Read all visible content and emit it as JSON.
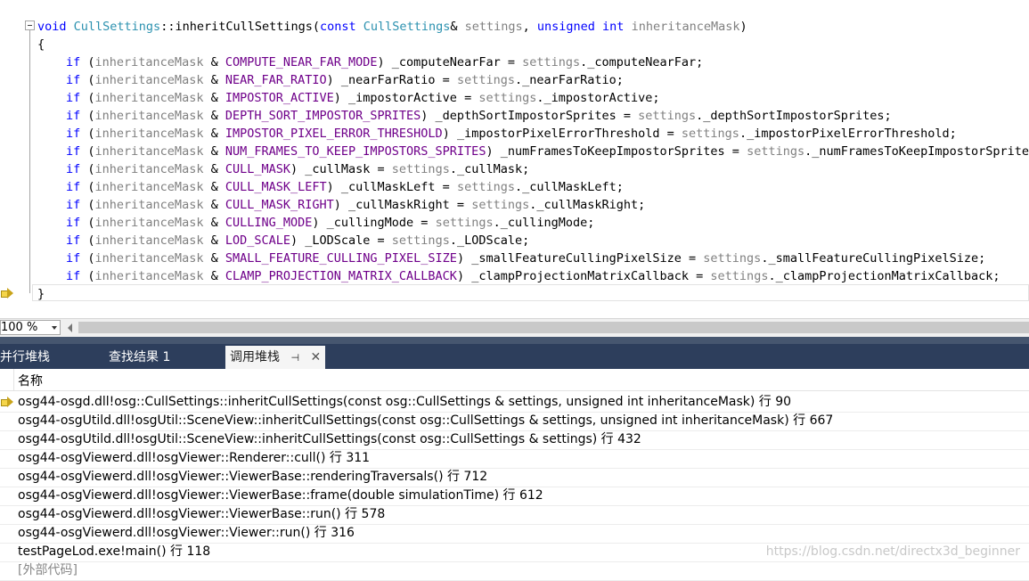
{
  "editor": {
    "code_lines": [
      [
        {
          "c": "kw",
          "t": "void"
        },
        {
          "c": "",
          "t": " "
        },
        {
          "c": "ty",
          "t": "CullSettings"
        },
        {
          "c": "",
          "t": "::inheritCullSettings("
        },
        {
          "c": "kw",
          "t": "const"
        },
        {
          "c": "",
          "t": " "
        },
        {
          "c": "ty",
          "t": "CullSettings"
        },
        {
          "c": "",
          "t": "& "
        },
        {
          "c": "pm",
          "t": "settings"
        },
        {
          "c": "",
          "t": ", "
        },
        {
          "c": "kw",
          "t": "unsigned int"
        },
        {
          "c": "",
          "t": " "
        },
        {
          "c": "pm",
          "t": "inheritanceMask"
        },
        {
          "c": "",
          "t": ")"
        }
      ],
      [
        {
          "c": "",
          "t": "{"
        }
      ],
      [
        {
          "c": "kw",
          "t": "if"
        },
        {
          "c": "",
          "t": " ("
        },
        {
          "c": "pm",
          "t": "inheritanceMask"
        },
        {
          "c": "",
          "t": " & "
        },
        {
          "c": "mc",
          "t": "COMPUTE_NEAR_FAR_MODE"
        },
        {
          "c": "",
          "t": ") _computeNearFar = "
        },
        {
          "c": "pm",
          "t": "settings"
        },
        {
          "c": "",
          "t": "._computeNearFar;"
        }
      ],
      [
        {
          "c": "kw",
          "t": "if"
        },
        {
          "c": "",
          "t": " ("
        },
        {
          "c": "pm",
          "t": "inheritanceMask"
        },
        {
          "c": "",
          "t": " & "
        },
        {
          "c": "mc",
          "t": "NEAR_FAR_RATIO"
        },
        {
          "c": "",
          "t": ") _nearFarRatio = "
        },
        {
          "c": "pm",
          "t": "settings"
        },
        {
          "c": "",
          "t": "._nearFarRatio;"
        }
      ],
      [
        {
          "c": "kw",
          "t": "if"
        },
        {
          "c": "",
          "t": " ("
        },
        {
          "c": "pm",
          "t": "inheritanceMask"
        },
        {
          "c": "",
          "t": " & "
        },
        {
          "c": "mc",
          "t": "IMPOSTOR_ACTIVE"
        },
        {
          "c": "",
          "t": ") _impostorActive = "
        },
        {
          "c": "pm",
          "t": "settings"
        },
        {
          "c": "",
          "t": "._impostorActive;"
        }
      ],
      [
        {
          "c": "kw",
          "t": "if"
        },
        {
          "c": "",
          "t": " ("
        },
        {
          "c": "pm",
          "t": "inheritanceMask"
        },
        {
          "c": "",
          "t": " & "
        },
        {
          "c": "mc",
          "t": "DEPTH_SORT_IMPOSTOR_SPRITES"
        },
        {
          "c": "",
          "t": ") _depthSortImpostorSprites = "
        },
        {
          "c": "pm",
          "t": "settings"
        },
        {
          "c": "",
          "t": "._depthSortImpostorSprites;"
        }
      ],
      [
        {
          "c": "kw",
          "t": "if"
        },
        {
          "c": "",
          "t": " ("
        },
        {
          "c": "pm",
          "t": "inheritanceMask"
        },
        {
          "c": "",
          "t": " & "
        },
        {
          "c": "mc",
          "t": "IMPOSTOR_PIXEL_ERROR_THRESHOLD"
        },
        {
          "c": "",
          "t": ") _impostorPixelErrorThreshold = "
        },
        {
          "c": "pm",
          "t": "settings"
        },
        {
          "c": "",
          "t": "._impostorPixelErrorThreshold;"
        }
      ],
      [
        {
          "c": "kw",
          "t": "if"
        },
        {
          "c": "",
          "t": " ("
        },
        {
          "c": "pm",
          "t": "inheritanceMask"
        },
        {
          "c": "",
          "t": " & "
        },
        {
          "c": "mc",
          "t": "NUM_FRAMES_TO_KEEP_IMPOSTORS_SPRITES"
        },
        {
          "c": "",
          "t": ") _numFramesToKeepImpostorSprites = "
        },
        {
          "c": "pm",
          "t": "settings"
        },
        {
          "c": "",
          "t": "._numFramesToKeepImpostorSprites;"
        }
      ],
      [
        {
          "c": "kw",
          "t": "if"
        },
        {
          "c": "",
          "t": " ("
        },
        {
          "c": "pm",
          "t": "inheritanceMask"
        },
        {
          "c": "",
          "t": " & "
        },
        {
          "c": "mc",
          "t": "CULL_MASK"
        },
        {
          "c": "",
          "t": ") _cullMask = "
        },
        {
          "c": "pm",
          "t": "settings"
        },
        {
          "c": "",
          "t": "._cullMask;"
        }
      ],
      [
        {
          "c": "kw",
          "t": "if"
        },
        {
          "c": "",
          "t": " ("
        },
        {
          "c": "pm",
          "t": "inheritanceMask"
        },
        {
          "c": "",
          "t": " & "
        },
        {
          "c": "mc",
          "t": "CULL_MASK_LEFT"
        },
        {
          "c": "",
          "t": ") _cullMaskLeft = "
        },
        {
          "c": "pm",
          "t": "settings"
        },
        {
          "c": "",
          "t": "._cullMaskLeft;"
        }
      ],
      [
        {
          "c": "kw",
          "t": "if"
        },
        {
          "c": "",
          "t": " ("
        },
        {
          "c": "pm",
          "t": "inheritanceMask"
        },
        {
          "c": "",
          "t": " & "
        },
        {
          "c": "mc",
          "t": "CULL_MASK_RIGHT"
        },
        {
          "c": "",
          "t": ") _cullMaskRight = "
        },
        {
          "c": "pm",
          "t": "settings"
        },
        {
          "c": "",
          "t": "._cullMaskRight;"
        }
      ],
      [
        {
          "c": "kw",
          "t": "if"
        },
        {
          "c": "",
          "t": " ("
        },
        {
          "c": "pm",
          "t": "inheritanceMask"
        },
        {
          "c": "",
          "t": " & "
        },
        {
          "c": "mc",
          "t": "CULLING_MODE"
        },
        {
          "c": "",
          "t": ") _cullingMode = "
        },
        {
          "c": "pm",
          "t": "settings"
        },
        {
          "c": "",
          "t": "._cullingMode;"
        }
      ],
      [
        {
          "c": "kw",
          "t": "if"
        },
        {
          "c": "",
          "t": " ("
        },
        {
          "c": "pm",
          "t": "inheritanceMask"
        },
        {
          "c": "",
          "t": " & "
        },
        {
          "c": "mc",
          "t": "LOD_SCALE"
        },
        {
          "c": "",
          "t": ") _LODScale = "
        },
        {
          "c": "pm",
          "t": "settings"
        },
        {
          "c": "",
          "t": "._LODScale;"
        }
      ],
      [
        {
          "c": "kw",
          "t": "if"
        },
        {
          "c": "",
          "t": " ("
        },
        {
          "c": "pm",
          "t": "inheritanceMask"
        },
        {
          "c": "",
          "t": " & "
        },
        {
          "c": "mc",
          "t": "SMALL_FEATURE_CULLING_PIXEL_SIZE"
        },
        {
          "c": "",
          "t": ") _smallFeatureCullingPixelSize = "
        },
        {
          "c": "pm",
          "t": "settings"
        },
        {
          "c": "",
          "t": "._smallFeatureCullingPixelSize;"
        }
      ],
      [
        {
          "c": "kw",
          "t": "if"
        },
        {
          "c": "",
          "t": " ("
        },
        {
          "c": "pm",
          "t": "inheritanceMask"
        },
        {
          "c": "",
          "t": " & "
        },
        {
          "c": "mc",
          "t": "CLAMP_PROJECTION_MATRIX_CALLBACK"
        },
        {
          "c": "",
          "t": ") _clampProjectionMatrixCallback = "
        },
        {
          "c": "pm",
          "t": "settings"
        },
        {
          "c": "",
          "t": "._clampProjectionMatrixCallback;"
        }
      ],
      [
        {
          "c": "",
          "t": "}"
        }
      ]
    ]
  },
  "status_bar": {
    "zoom": "100 %"
  },
  "tabs": [
    {
      "label": "并行堆栈"
    },
    {
      "label": "查找结果 1"
    },
    {
      "label": "调用堆栈"
    }
  ],
  "icons": {
    "pin": "pin-icon",
    "close": "close-icon",
    "current_line": "yellow-arrow-icon"
  },
  "colors": {
    "keyword": "#0000ff",
    "type": "#2b91af",
    "param": "#808080",
    "macro": "#6f008a",
    "tab_strip": "#2d3e5c"
  },
  "callstack": {
    "column_header": "名称",
    "frames": [
      "osg44-osgd.dll!osg::CullSettings::inheritCullSettings(const osg::CullSettings & settings, unsigned int inheritanceMask) 行 90",
      "osg44-osgUtild.dll!osgUtil::SceneView::inheritCullSettings(const osg::CullSettings & settings, unsigned int inheritanceMask) 行 667",
      "osg44-osgUtild.dll!osgUtil::SceneView::inheritCullSettings(const osg::CullSettings & settings) 行 432",
      "osg44-osgViewerd.dll!osgViewer::Renderer::cull() 行 311",
      "osg44-osgViewerd.dll!osgViewer::ViewerBase::renderingTraversals() 行 712",
      "osg44-osgViewerd.dll!osgViewer::ViewerBase::frame(double simulationTime) 行 612",
      "osg44-osgViewerd.dll!osgViewer::ViewerBase::run() 行 578",
      "osg44-osgViewerd.dll!osgViewer::Viewer::run() 行 316",
      "testPageLod.exe!main() 行 118",
      "[外部代码]"
    ]
  },
  "watermark": "https://blog.csdn.net/directx3d_beginner"
}
